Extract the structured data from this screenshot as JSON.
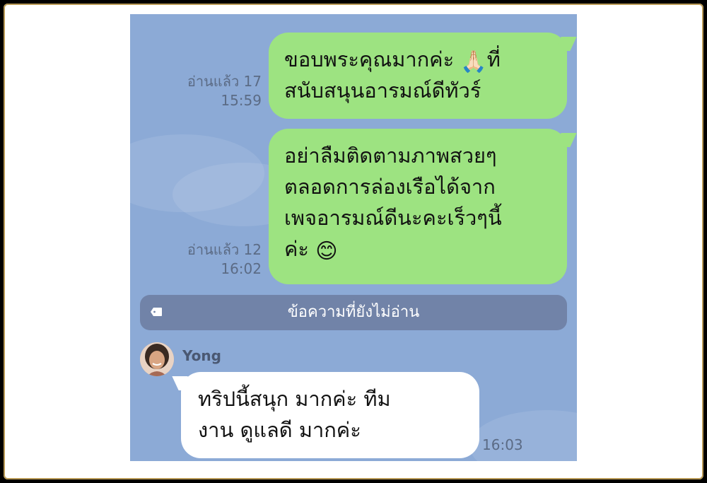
{
  "messages_out": [
    {
      "lines": [
        "ขอบพระคุณมากค่ะ",
        "สนับสนุนอารมณ์ดีทัวร์"
      ],
      "line1_tail": "ที่",
      "emoji": "🙏🏻",
      "read_status": "อ่านแล้ว 17",
      "time": "15:59"
    },
    {
      "lines": [
        "อย่าลืมติดตามภาพสวยๆ",
        "ตลอดการล่องเรือได้จาก",
        "เพจอารมณ์ดีนะคะเร็วๆนี้",
        "ค่ะ"
      ],
      "emoji": "😊",
      "read_status": "อ่านแล้ว 12",
      "time": "16:02"
    }
  ],
  "unread_divider": {
    "label": "ข้อความที่ยังไม่อ่าน",
    "icon": "tag-icon"
  },
  "incoming": {
    "sender": "Yong",
    "avatar_icon": "avatar",
    "lines": [
      "ทริปนี้สนุก มากค่ะ ทีม",
      "งาน ดูแลดี มากค่ะ"
    ],
    "time": "16:03"
  },
  "colors": {
    "chat_background": "#8caad6",
    "outgoing_bubble": "#9de381",
    "incoming_bubble": "#ffffff",
    "unread_bar": "#7183a8"
  }
}
